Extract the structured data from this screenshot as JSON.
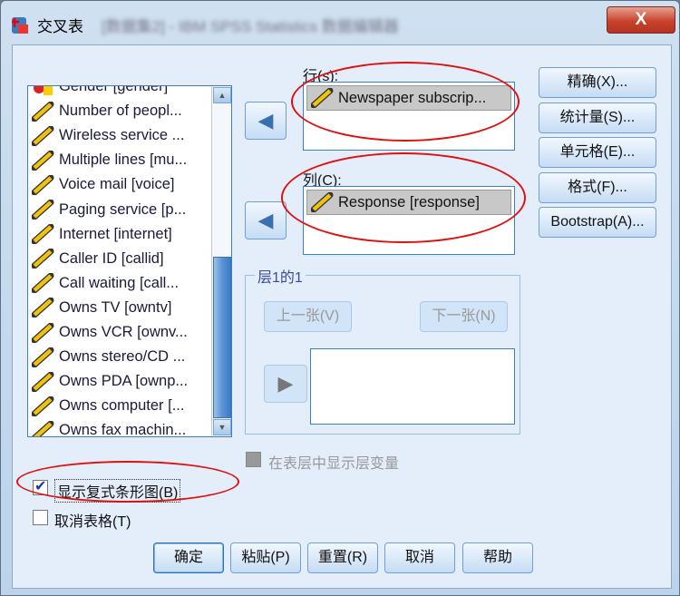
{
  "window": {
    "title": "交叉表",
    "background_title": "[数据集2] - IBM SPSS Statistics 数据编辑器",
    "close_label": "X"
  },
  "variables": [
    {
      "label": "Gender [gender]",
      "type": "nominal"
    },
    {
      "label": "Number of peopl...",
      "type": "scale"
    },
    {
      "label": "Wireless service ...",
      "type": "scale"
    },
    {
      "label": "Multiple lines [mu...",
      "type": "scale"
    },
    {
      "label": "Voice mail [voice]",
      "type": "scale"
    },
    {
      "label": "Paging service [p...",
      "type": "scale"
    },
    {
      "label": "Internet [internet]",
      "type": "scale"
    },
    {
      "label": "Caller ID [callid]",
      "type": "scale"
    },
    {
      "label": "Call waiting [call...",
      "type": "scale"
    },
    {
      "label": "Owns TV [owntv]",
      "type": "scale"
    },
    {
      "label": "Owns VCR [ownv...",
      "type": "scale"
    },
    {
      "label": "Owns stereo/CD ...",
      "type": "scale"
    },
    {
      "label": "Owns PDA [ownp...",
      "type": "scale"
    },
    {
      "label": "Owns computer [...",
      "type": "scale"
    },
    {
      "label": "Owns fax machin...",
      "type": "scale"
    }
  ],
  "rows": {
    "label": "行(s):",
    "items": [
      "Newspaper subscrip..."
    ]
  },
  "columns": {
    "label": "列(C):",
    "items": [
      "Response [response]"
    ]
  },
  "layer": {
    "label": "层1的1",
    "prev": "上一张(V)",
    "next": "下一张(N)"
  },
  "show_layer_vars": {
    "label": "在表层中显示层变量",
    "checked": false,
    "enabled": false
  },
  "clustered_bar": {
    "label": "显示复式条形图(B)",
    "checked": true
  },
  "suppress_tables": {
    "label": "取消表格(T)",
    "checked": false
  },
  "side_buttons": [
    "精确(X)...",
    "统计量(S)...",
    "单元格(E)...",
    "格式(F)...",
    "Bootstrap(A)..."
  ],
  "bottom_buttons": [
    "确定",
    "粘贴(P)",
    "重置(R)",
    "取消",
    "帮助"
  ],
  "colors": {
    "annotation": "#e01010",
    "accent": "#3c7fc9"
  }
}
